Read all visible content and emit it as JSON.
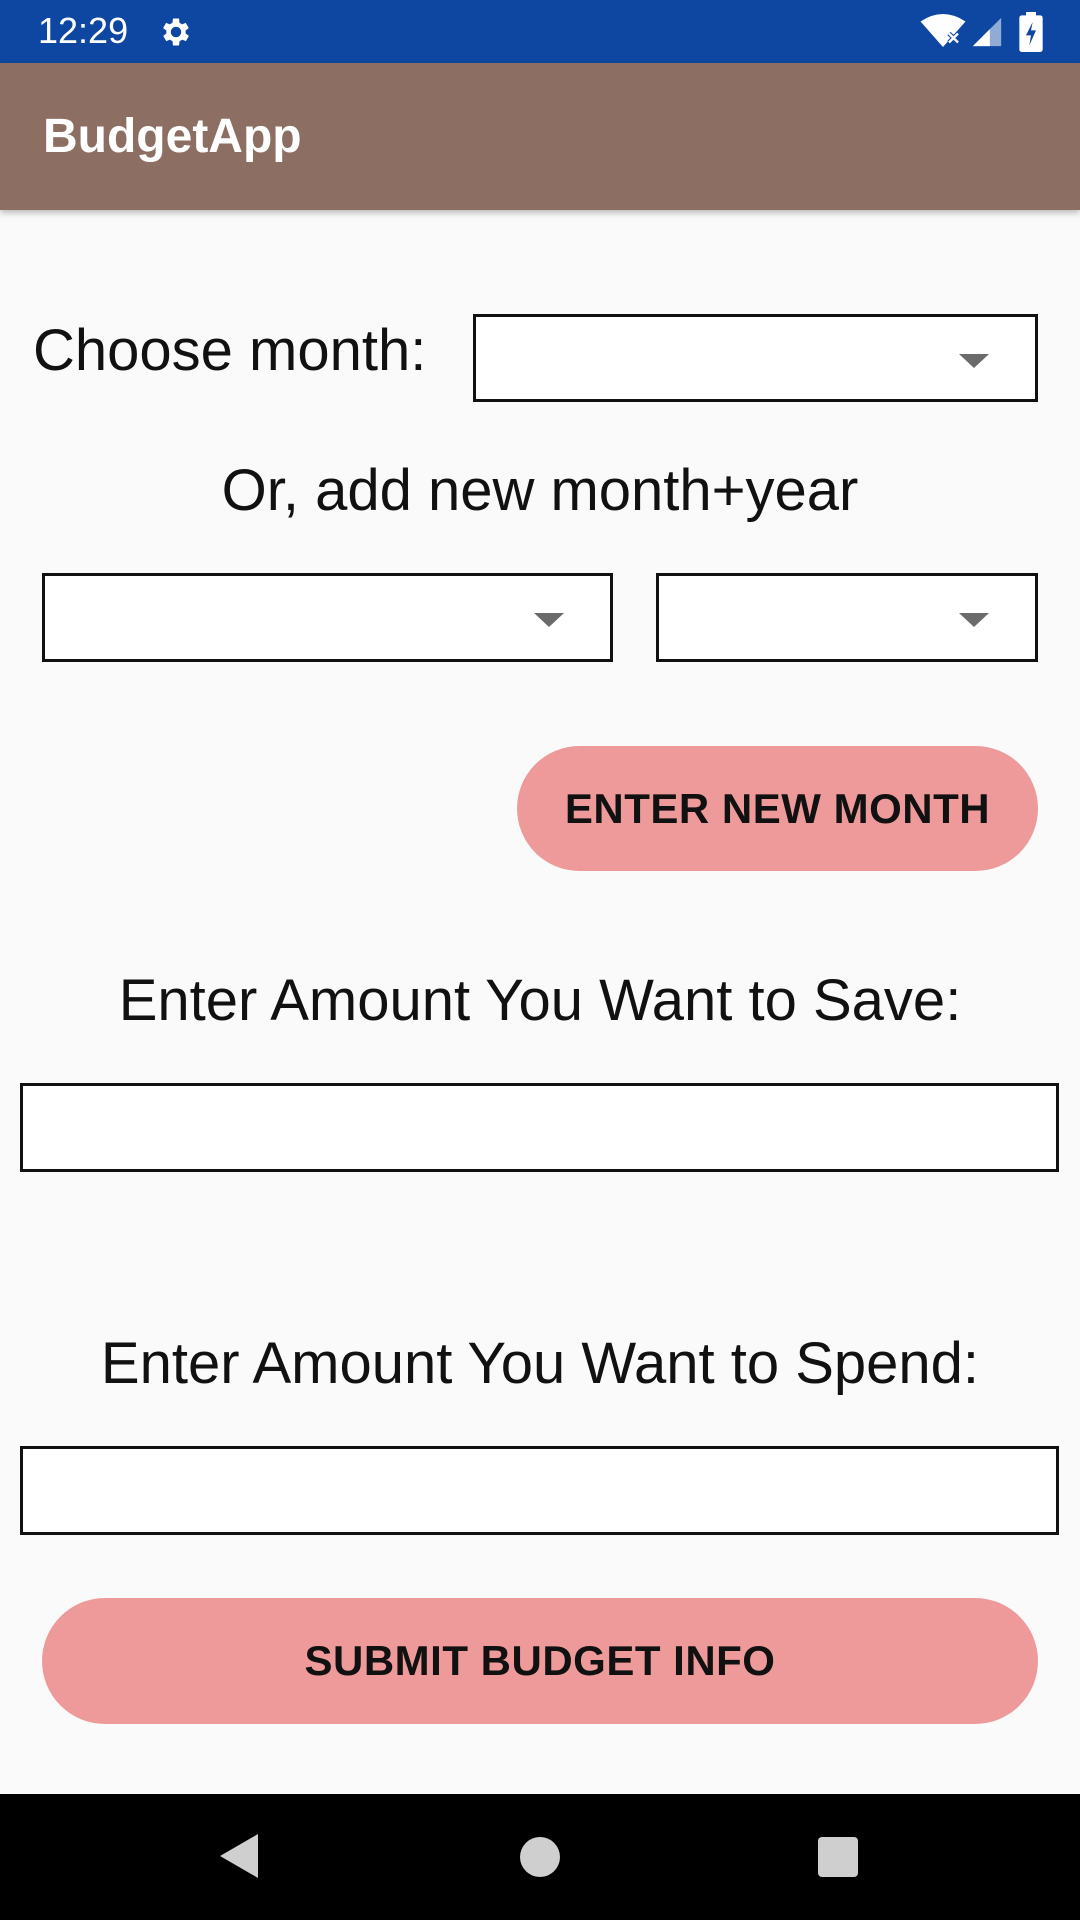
{
  "status_bar": {
    "time": "12:29",
    "icons": [
      "settings-gear-icon",
      "wifi-icon",
      "cell-signal-icon",
      "battery-charging-icon"
    ]
  },
  "app_bar": {
    "title": "BudgetApp",
    "color": "#8d6e63"
  },
  "form": {
    "choose_month_label": "Choose month:",
    "choose_month_value": "",
    "or_add_label": "Or, add new month+year",
    "new_month_value": "",
    "new_year_value": "",
    "enter_new_month_button": "ENTER NEW MONTH",
    "save_label": "Enter Amount You Want to Save:",
    "save_value": "",
    "spend_label": "Enter Amount You Want to Spend:",
    "spend_value": "",
    "submit_button": "SUBMIT BUDGET INFO"
  },
  "colors": {
    "status_bar": "#0d47a1",
    "accent_button": "#ef9a9a",
    "background": "#fafafa"
  },
  "nav_bar": {
    "icons": [
      "back-icon",
      "home-icon",
      "recents-icon"
    ]
  }
}
